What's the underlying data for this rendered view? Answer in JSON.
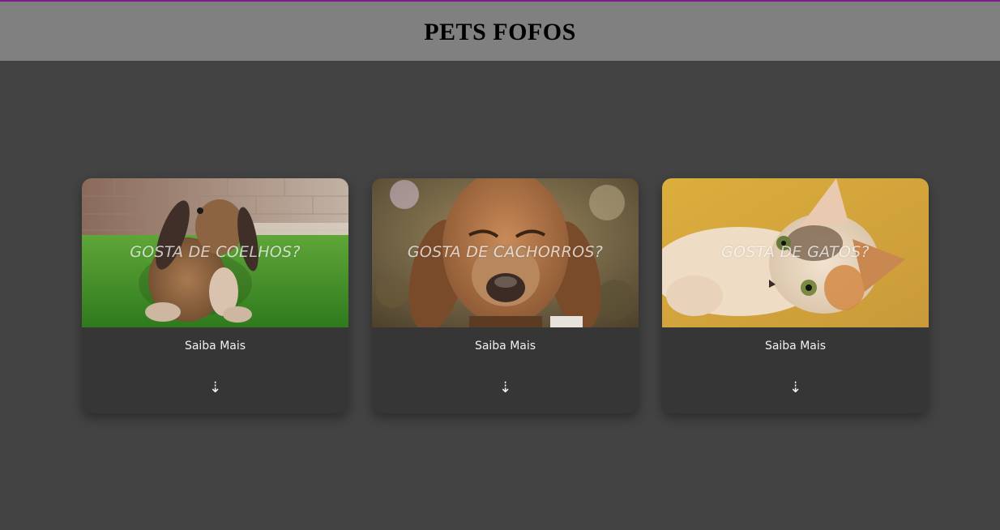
{
  "header": {
    "title": "PETS FOFOS"
  },
  "cards": [
    {
      "title": "GOSTA DE COELHOS?",
      "link_label": "Saiba Mais",
      "arrow": "⇣",
      "image": "rabbit-photo"
    },
    {
      "title": "GOSTA DE CACHORROS?",
      "link_label": "Saiba Mais",
      "arrow": "⇣",
      "image": "dog-photo"
    },
    {
      "title": "GOSTA DE GATOS?",
      "link_label": "Saiba Mais",
      "arrow": "⇣",
      "image": "cat-photo"
    }
  ],
  "colors": {
    "background": "#434343",
    "header_bg": "#808080",
    "card_bg": "#363636",
    "top_accent": "#7a1f86"
  }
}
